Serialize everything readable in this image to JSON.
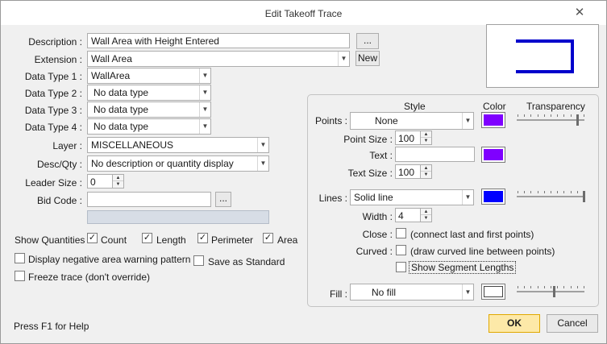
{
  "window": {
    "title": "Edit Takeoff Trace",
    "close_glyph": "✕"
  },
  "description": {
    "label": "Description :",
    "value": "Wall Area with Height Entered",
    "browse_label": "..."
  },
  "extension": {
    "label": "Extension :",
    "value": "Wall Area",
    "new_label": "New"
  },
  "data_types": [
    {
      "label": "Data Type 1 :",
      "value": "WallArea"
    },
    {
      "label": "Data Type 2 :",
      "value": "No data type"
    },
    {
      "label": "Data Type 3 :",
      "value": "No data type"
    },
    {
      "label": "Data Type 4 :",
      "value": "No data type"
    }
  ],
  "layer": {
    "label": "Layer :",
    "value": "MISCELLANEOUS"
  },
  "desc_qty": {
    "label": "Desc/Qty :",
    "value": "No description or quantity display"
  },
  "leader_size": {
    "label": "Leader Size :",
    "value": "0"
  },
  "bid_code": {
    "label": "Bid Code :",
    "value": "",
    "browse_label": "..."
  },
  "show_quantities": {
    "label": "Show Quantities :",
    "items": [
      {
        "label": "Count",
        "checked": true
      },
      {
        "label": "Length",
        "checked": true
      },
      {
        "label": "Perimeter",
        "checked": true
      },
      {
        "label": "Area",
        "checked": true
      }
    ]
  },
  "options": {
    "negative_area": {
      "label": "Display negative area warning pattern",
      "checked": false
    },
    "save_standard": {
      "label": "Save as Standard",
      "checked": false
    },
    "freeze": {
      "label": "Freeze trace (don't override)",
      "checked": false
    }
  },
  "style_panel": {
    "headers": {
      "style": "Style",
      "color": "Color",
      "transparency": "Transparency"
    },
    "points": {
      "label": "Points :",
      "value": "None",
      "color": "#7f00ff",
      "transparency": 0.9
    },
    "point_size": {
      "label": "Point Size :",
      "value": "100"
    },
    "text": {
      "label": "Text :",
      "value": "",
      "color": "#7f00ff"
    },
    "text_size": {
      "label": "Text Size :",
      "value": "100"
    },
    "lines": {
      "label": "Lines :",
      "value": "Solid line",
      "color": "#0000ff",
      "transparency": 1.0
    },
    "width": {
      "label": "Width :",
      "value": "4"
    },
    "close": {
      "label": "Close :",
      "desc": "(connect last and first points)",
      "checked": false
    },
    "curved": {
      "label": "Curved :",
      "desc": "(draw curved line between points)",
      "checked": false
    },
    "segment_lengths": {
      "label": "Show Segment Lengths",
      "checked": false
    },
    "fill": {
      "label": "Fill :",
      "value": "No fill",
      "color": "#ffffff",
      "transparency": 0.55
    }
  },
  "footer": {
    "help": "Press F1 for Help",
    "ok_label": "OK",
    "cancel_label": "Cancel"
  },
  "colors": {
    "preview_line": "#0000cc",
    "ok_border": "#e0a800",
    "ok_bg": "#fde9a8"
  }
}
